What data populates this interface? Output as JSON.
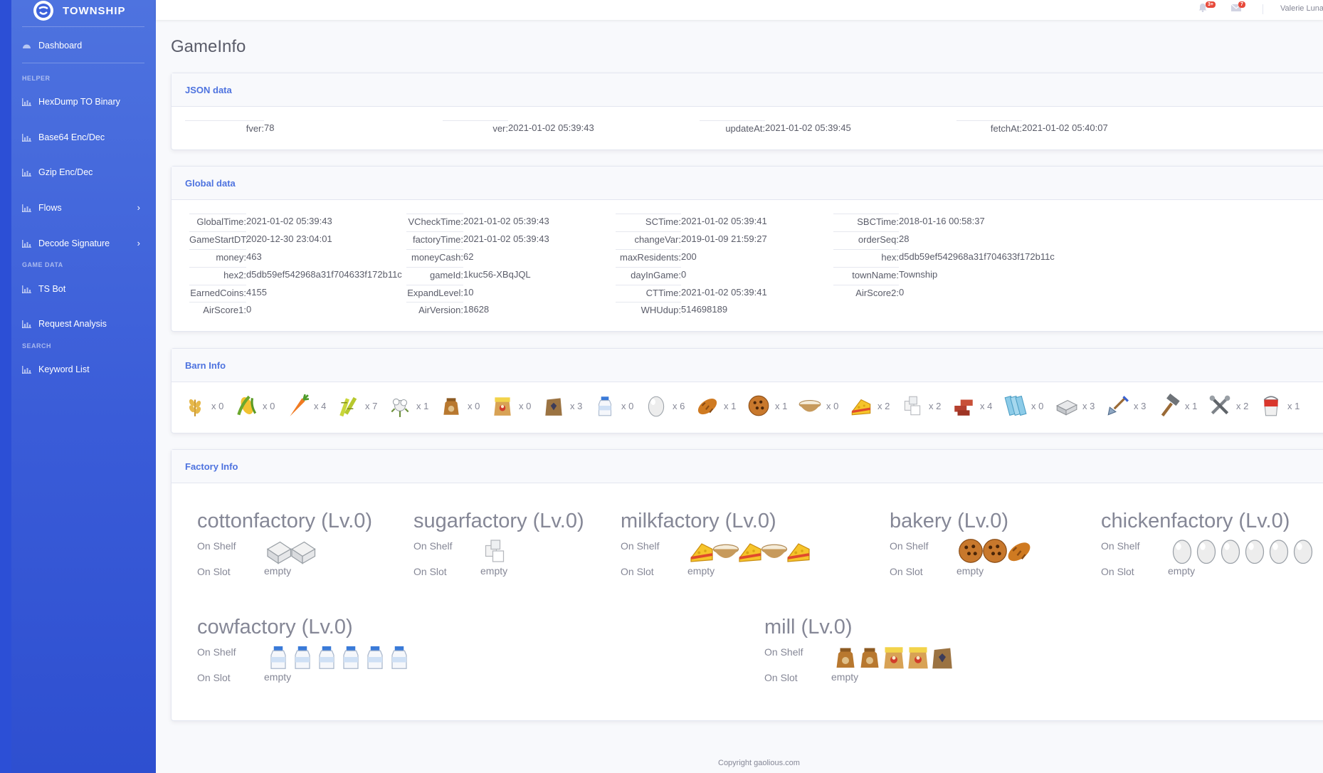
{
  "brand": {
    "name": "TOWNSHIP"
  },
  "sidebar": {
    "dashboard": "Dashboard",
    "heading_helper": "HELPER",
    "heading_game_data": "GAME DATA",
    "heading_search": "SEARCH",
    "items": [
      {
        "label": "HexDump TO Binary"
      },
      {
        "label": "Base64 Enc/Dec"
      },
      {
        "label": "Gzip Enc/Dec"
      },
      {
        "label": "Flows"
      },
      {
        "label": "Decode Signature"
      },
      {
        "label": "TS Bot"
      },
      {
        "label": "Request Analysis"
      },
      {
        "label": "Keyword List"
      }
    ]
  },
  "topbar": {
    "alerts_badge": "3+",
    "messages_badge": "7",
    "user": "Valerie Luna"
  },
  "page": {
    "title": "GameInfo"
  },
  "json_card": {
    "title": "JSON data",
    "fields": [
      {
        "k": "fver",
        "v": "78"
      },
      {
        "k": "ver",
        "v": "2021-01-02 05:39:43"
      },
      {
        "k": "updateAt",
        "v": "2021-01-02 05:39:45"
      },
      {
        "k": "fetchAt",
        "v": "2021-01-02 05:40:07"
      }
    ]
  },
  "global_card": {
    "title": "Global data",
    "columns": [
      [
        {
          "k": "GlobalTime",
          "v": "2021-01-02 05:39:43"
        },
        {
          "k": "GameStartDT",
          "v": "2020-12-30 23:04:01"
        },
        {
          "k": "money",
          "v": "463"
        },
        {
          "k": "hex2",
          "v": "d5db59ef542968a31f704633f172b11c"
        },
        {
          "k": "EarnedCoins",
          "v": "4155"
        },
        {
          "k": "AirScore1",
          "v": "0"
        }
      ],
      [
        {
          "k": "VCheckTime",
          "v": "2021-01-02 05:39:43"
        },
        {
          "k": "factoryTime",
          "v": "2021-01-02 05:39:43"
        },
        {
          "k": "moneyCash",
          "v": "62"
        },
        {
          "k": "gameId",
          "v": "1kuc56-XBqJQL"
        },
        {
          "k": "ExpandLevel",
          "v": "10"
        },
        {
          "k": "AirVersion",
          "v": "18628"
        }
      ],
      [
        {
          "k": "SCTime",
          "v": "2021-01-02 05:39:41"
        },
        {
          "k": "changeVar",
          "v": "2019-01-09 21:59:27"
        },
        {
          "k": "maxResidents",
          "v": "200"
        },
        {
          "k": "dayInGame",
          "v": "0"
        },
        {
          "k": "CTTime",
          "v": "2021-01-02 05:39:41"
        },
        {
          "k": "WHUdup",
          "v": "514698189"
        }
      ],
      [
        {
          "k": "SBCTime",
          "v": "2018-01-16 00:58:37"
        },
        {
          "k": "orderSeq",
          "v": "28"
        },
        {
          "k": "hex",
          "v": "d5db59ef542968a31f704633f172b11c"
        },
        {
          "k": "townName",
          "v": "Township"
        },
        {
          "k": "AirScore2",
          "v": "0"
        }
      ]
    ]
  },
  "barn_card": {
    "title": "Barn Info",
    "items": [
      {
        "icon": "wheat-icon",
        "count": "x 0"
      },
      {
        "icon": "corn-icon",
        "count": "x 0"
      },
      {
        "icon": "carrot-icon",
        "count": "x 4"
      },
      {
        "icon": "sugarcane-icon",
        "count": "x 7"
      },
      {
        "icon": "cotton-icon",
        "count": "x 1"
      },
      {
        "icon": "cow-feed-icon",
        "count": "x 0"
      },
      {
        "icon": "chicken-feed-icon",
        "count": "x 0"
      },
      {
        "icon": "flour-sack-icon",
        "count": "x 3"
      },
      {
        "icon": "milk-bottle-icon",
        "count": "x 0"
      },
      {
        "icon": "egg-icon",
        "count": "x 6"
      },
      {
        "icon": "bread-icon",
        "count": "x 1"
      },
      {
        "icon": "cookie-icon",
        "count": "x 1"
      },
      {
        "icon": "cream-bowl-icon",
        "count": "x 0"
      },
      {
        "icon": "cheese-icon",
        "count": "x 2"
      },
      {
        "icon": "sugar-cube-icon",
        "count": "x 2"
      },
      {
        "icon": "brick-icon",
        "count": "x 4"
      },
      {
        "icon": "glass-icon",
        "count": "x 0"
      },
      {
        "icon": "slab-icon",
        "count": "x 3"
      },
      {
        "icon": "shovel-icon",
        "count": "x 3"
      },
      {
        "icon": "hammer-icon",
        "count": "x 1"
      },
      {
        "icon": "wrench-icon",
        "count": "x 2"
      },
      {
        "icon": "paint-bucket-icon",
        "count": "x 1"
      }
    ]
  },
  "factory_card": {
    "title": "Factory Info",
    "on_shelf": "On Shelf",
    "on_slot": "On Slot",
    "empty": "empty",
    "factories": [
      {
        "name": "cottonfactory (Lv.0)",
        "shelf": [
          "fabric-icon",
          "fabric-icon"
        ]
      },
      {
        "name": "sugarfactory (Lv.0)",
        "shelf": [
          "sugar-cube-icon"
        ]
      },
      {
        "name": "milkfactory (Lv.0)",
        "shelf": [
          "cheese-icon",
          "cream-bowl-icon",
          "cheese-icon",
          "cream-bowl-icon",
          "cheese-icon"
        ]
      },
      {
        "name": "bakery (Lv.0)",
        "shelf": [
          "cookie-icon",
          "cookie-icon",
          "bread-icon"
        ]
      },
      {
        "name": "chickenfactory (Lv.0)",
        "shelf": [
          "egg-icon",
          "egg-icon",
          "egg-icon",
          "egg-icon",
          "egg-icon",
          "egg-icon"
        ]
      },
      {
        "name": "cowfactory (Lv.0)",
        "shelf": [
          "milk-bottle-icon",
          "milk-bottle-icon",
          "milk-bottle-icon",
          "milk-bottle-icon",
          "milk-bottle-icon",
          "milk-bottle-icon"
        ]
      },
      {
        "name": "mill (Lv.0)",
        "shelf": [
          "cow-feed-icon",
          "cow-feed-icon",
          "chicken-feed-icon",
          "chicken-feed-icon",
          "flour-sack-icon"
        ]
      }
    ]
  },
  "footer": {
    "text": "Copyright gaolious.com"
  }
}
